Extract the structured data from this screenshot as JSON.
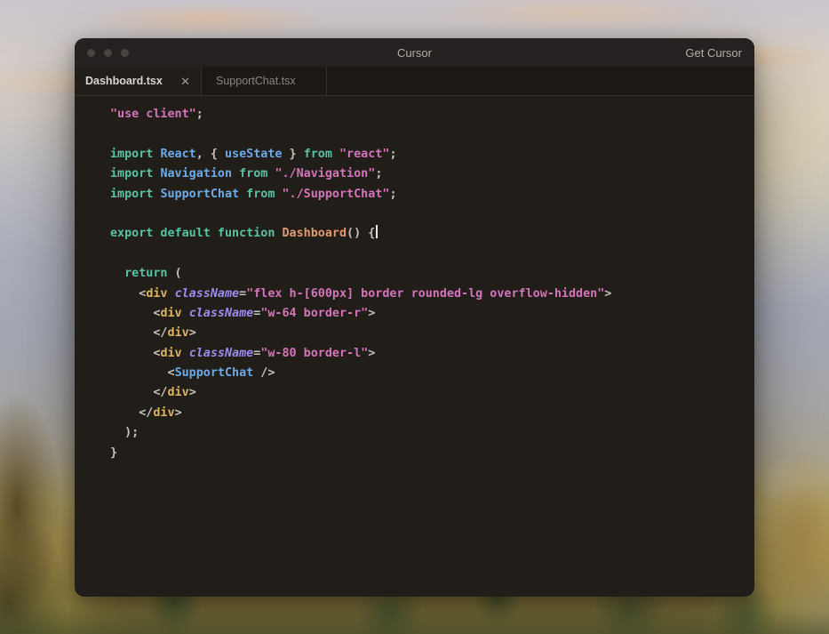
{
  "window": {
    "title": "Cursor",
    "get_cursor_label": "Get Cursor"
  },
  "tabs": [
    {
      "label": "Dashboard.tsx",
      "active": true
    },
    {
      "label": "SupportChat.tsx",
      "active": false
    }
  ],
  "icons": {
    "close": "✕"
  },
  "palette": {
    "editor_bg": "#211d19",
    "titlebar_bg": "#242120",
    "tabstrip_bg": "#1b1815",
    "divider": "#393430",
    "keyword": "#59c2a4",
    "identifier": "#6cabe8",
    "string": "#d375b9",
    "punctuation": "#c9c2ba",
    "tag": "#dcb45f",
    "attribute": "#9e8df0",
    "function_name": "#e09a6d",
    "active_tab_text": "#dad5cf",
    "inactive_tab_text": "#8d8680"
  },
  "code": {
    "lines": [
      [
        {
          "c": "str",
          "t": "\"use client\""
        },
        {
          "c": "pun",
          "t": ";"
        }
      ],
      [],
      [
        {
          "c": "kw",
          "t": "import "
        },
        {
          "c": "id",
          "t": "React"
        },
        {
          "c": "pun",
          "t": ", { "
        },
        {
          "c": "id",
          "t": "useState"
        },
        {
          "c": "pun",
          "t": " } "
        },
        {
          "c": "kw",
          "t": "from "
        },
        {
          "c": "str",
          "t": "\"react\""
        },
        {
          "c": "pun",
          "t": ";"
        }
      ],
      [
        {
          "c": "kw",
          "t": "import "
        },
        {
          "c": "id",
          "t": "Navigation"
        },
        {
          "c": "kw",
          "t": " from "
        },
        {
          "c": "str",
          "t": "\"./Navigation\""
        },
        {
          "c": "pun",
          "t": ";"
        }
      ],
      [
        {
          "c": "kw",
          "t": "import "
        },
        {
          "c": "id",
          "t": "SupportChat"
        },
        {
          "c": "kw",
          "t": " from "
        },
        {
          "c": "str",
          "t": "\"./SupportChat\""
        },
        {
          "c": "pun",
          "t": ";"
        }
      ],
      [],
      [
        {
          "c": "kw",
          "t": "export default function "
        },
        {
          "c": "fn",
          "t": "Dashboard"
        },
        {
          "c": "pun",
          "t": "() {"
        },
        {
          "c": "caret",
          "t": ""
        }
      ],
      [],
      [
        {
          "c": "pun",
          "t": "  "
        },
        {
          "c": "kw",
          "t": "return"
        },
        {
          "c": "pun",
          "t": " ("
        }
      ],
      [
        {
          "c": "pun",
          "t": "    <"
        },
        {
          "c": "tag",
          "t": "div"
        },
        {
          "c": "pun",
          "t": " "
        },
        {
          "c": "attr",
          "t": "className"
        },
        {
          "c": "pun",
          "t": "="
        },
        {
          "c": "str",
          "t": "\"flex h-[600px] border rounded-lg overflow-hidden\""
        },
        {
          "c": "pun",
          "t": ">"
        }
      ],
      [
        {
          "c": "pun",
          "t": "      <"
        },
        {
          "c": "tag",
          "t": "div"
        },
        {
          "c": "pun",
          "t": " "
        },
        {
          "c": "attr",
          "t": "className"
        },
        {
          "c": "pun",
          "t": "="
        },
        {
          "c": "str",
          "t": "\"w-64 border-r\""
        },
        {
          "c": "pun",
          "t": ">"
        }
      ],
      [
        {
          "c": "pun",
          "t": "      </"
        },
        {
          "c": "tag",
          "t": "div"
        },
        {
          "c": "pun",
          "t": ">"
        }
      ],
      [
        {
          "c": "pun",
          "t": "      <"
        },
        {
          "c": "tag",
          "t": "div"
        },
        {
          "c": "pun",
          "t": " "
        },
        {
          "c": "attr",
          "t": "className"
        },
        {
          "c": "pun",
          "t": "="
        },
        {
          "c": "str",
          "t": "\"w-80 border-l\""
        },
        {
          "c": "pun",
          "t": ">"
        }
      ],
      [
        {
          "c": "pun",
          "t": "        <"
        },
        {
          "c": "id",
          "t": "SupportChat"
        },
        {
          "c": "pun",
          "t": " />"
        }
      ],
      [
        {
          "c": "pun",
          "t": "      </"
        },
        {
          "c": "tag",
          "t": "div"
        },
        {
          "c": "pun",
          "t": ">"
        }
      ],
      [
        {
          "c": "pun",
          "t": "    </"
        },
        {
          "c": "tag",
          "t": "div"
        },
        {
          "c": "pun",
          "t": ">"
        }
      ],
      [
        {
          "c": "pun",
          "t": "  );"
        }
      ],
      [
        {
          "c": "pun",
          "t": "}"
        }
      ]
    ]
  }
}
